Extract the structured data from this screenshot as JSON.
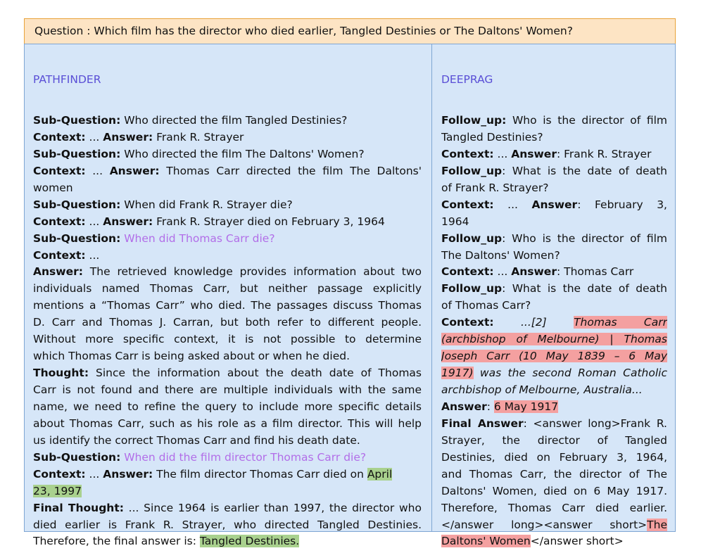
{
  "question": "Question : Which film has the director who died earlier, Tangled Destinies or The Daltons' Women?",
  "left": {
    "title": "PATHFINDER",
    "l1_label": "Sub-Question:",
    "l1_text": " Who directed the film Tangled Destinies?",
    "l2_ctx": "Context:",
    "l2_dots": " ... ",
    "l2_ans": "Answer:",
    "l2_text": " Frank R. Strayer",
    "l3_label": "Sub-Question:",
    "l3_text": " Who directed the film The Daltons' Women?",
    "l4_ctx": "Context:",
    "l4_dots": " ... ",
    "l4_ans": "Answer:",
    "l4_text": " Thomas Carr directed the film The Daltons'",
    "l5_text": "women",
    "l6_label": "Sub-Question:",
    "l6_text": " When did Frank R. Strayer die?",
    "l7_ctx": "Context:",
    "l7_dots": " ... ",
    "l7_ans": "Answer:",
    "l7_text": " Frank R. Strayer died on February 3, 1964",
    "l8_label": "Sub-Question:",
    "l8_text": " When did Thomas Carr die?",
    "l9_ctx": "Context:",
    "l9_dots": " ...",
    "l10_ans": "Answer:",
    "l10_text": " The retrieved knowledge provides information about two",
    "l11_text": "individuals named Thomas Carr, but neither passage explicitly",
    "l12_text": "mentions a “Thomas Carr” who died. The passages discuss Thomas",
    "l13_text": "D. Carr and Thomas J. Carran, but both refer to different people.",
    "l14_text": "Without more specific context, it is not possible to determine",
    "l15_text": "which Thomas Carr is being asked about or when he died.",
    "l16_label": "Thought:",
    "l16_text": " Since the information about the death date of Thomas",
    "l17_text": "Carr is not found and there are multiple individuals with the same",
    "l18_text": "name, we need to refine the query to include more specific details",
    "l19_text": "about Thomas Carr, such as his role as a film director. This will help",
    "l20_text": "us identify the correct Thomas Carr and find his death date.",
    "l21_label": "Sub-Question:",
    "l21_text": " When did the film director Thomas Carr die?",
    "l22_ctx": "Context:",
    "l22_dots": " ... ",
    "l22_ans": "Answer:",
    "l22_text": " The film director Thomas Carr died on ",
    "l22_hl": "April",
    "l23_hl": "23, 1997",
    "l24_label": "Final Thought:",
    "l24_text": " ... Since 1964 is earlier than 1997, the director who",
    "l25_text": "died earlier is Frank R. Strayer, who directed Tangled Destinies.",
    "l26_text": "Therefore, the final answer is: ",
    "l26_hl": "Tangled Destinies."
  },
  "right": {
    "title": "DEEPRAG",
    "r1_label": "Follow_up:",
    "r1_text": " Who is the director of film",
    "r2_text": "Tangled Destinies?",
    "r3_ctx": "Context:",
    "r3_dots": " ... ",
    "r3_ans": "Answer",
    "r3_text": ": Frank R. Strayer",
    "r4_label": "Follow_up",
    "r4_text": ": What is the date of death",
    "r5_text": "of Frank R. Strayer?",
    "r6_ctx": "Context:",
    "r6_dots": " ... ",
    "r6_ans": "Answer",
    "r6_text": ": February 3,",
    "r7_text": "1964",
    "r8_label": "Follow_up",
    "r8_text": ": Who is the director of film",
    "r9_text": "The Daltons' Women?",
    "r10_ctx": "Context:",
    "r10_dots": " ... ",
    "r10_ans": "Answer",
    "r10_text": ": Thomas Carr",
    "r11_label": "Follow_up",
    "r11_text": ": What is the date of death",
    "r12_text": "of Thomas Carr?",
    "r13_ctx": "Context:",
    "r13_ref": " ...[2] ",
    "r13_hl": "Thomas Carr",
    "r14_hl": "(archbishop of Melbourne) | Thomas",
    "r15_hl": "Joseph Carr (10 May 1839 – 6 May",
    "r16_hl": "1917)",
    "r16_text": " was the second Roman Catholic",
    "r17_text": "archbishop of Melbourne, Australia...",
    "r18_ans": "Answer",
    "r18_colon": ": ",
    "r18_hl": "6 May 1917",
    "r19_label": "Final Answer",
    "r19_text": ": <answer long>Frank R.",
    "r20_text": "Strayer, the director of Tangled",
    "r21_text": "Destinies, died on February 3, 1964,",
    "r22_text": "and Thomas Carr, the director of The",
    "r23_text": "Daltons' Women, died on 6 May 1917.",
    "r24_text": "Therefore, Thomas Carr died earlier.",
    "r25_text": "</answer long><answer short>",
    "r25_hl": "The",
    "r26_hl": "Daltons' Women",
    "r26_text": "</answer short>"
  }
}
